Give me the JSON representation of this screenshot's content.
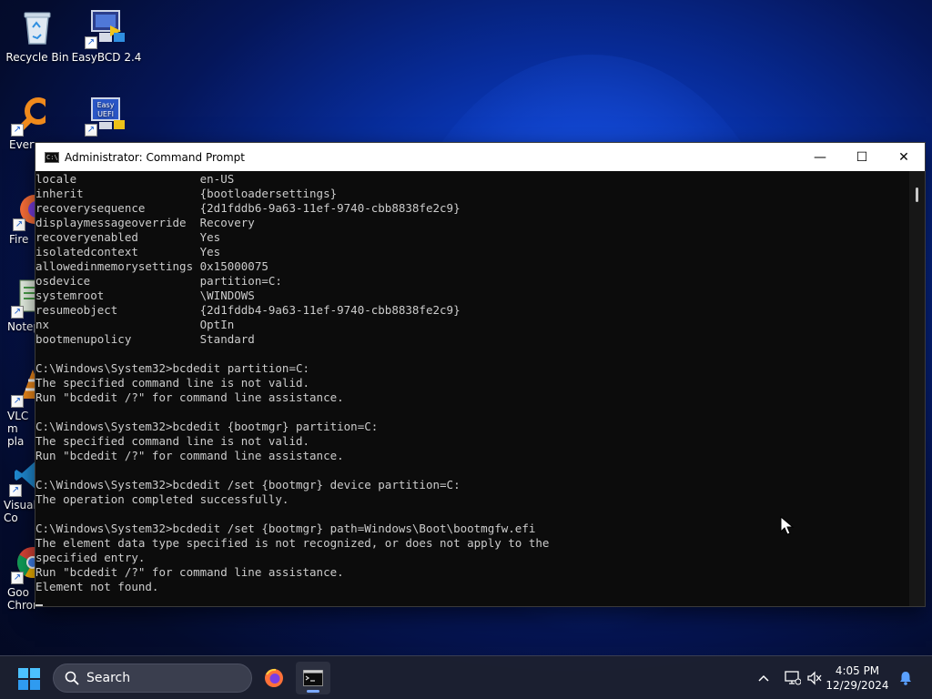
{
  "desktop": {
    "icons": [
      {
        "label": "Recycle Bin"
      },
      {
        "label": "EasyBCD 2.4"
      },
      {
        "label": "Every"
      },
      {
        "label": "Easy UEFI",
        "badge": "Easy UEFI"
      },
      {
        "label": "Fire"
      },
      {
        "label": "Notep"
      },
      {
        "label": "VLC m pla"
      },
      {
        "label": "Visual Co"
      },
      {
        "label": "Goo Chrome"
      }
    ]
  },
  "window": {
    "title": "Administrator: Command Prompt",
    "icon_label": "C:\\",
    "controls": {
      "minimize": "—",
      "maximize": "☐",
      "close": "✕"
    }
  },
  "console": {
    "lines": [
      "locale                  en-US",
      "inherit                 {bootloadersettings}",
      "recoverysequence        {2d1fddb6-9a63-11ef-9740-cbb8838fe2c9}",
      "displaymessageoverride  Recovery",
      "recoveryenabled         Yes",
      "isolatedcontext         Yes",
      "allowedinmemorysettings 0x15000075",
      "osdevice                partition=C:",
      "systemroot              \\WINDOWS",
      "resumeobject            {2d1fddb4-9a63-11ef-9740-cbb8838fe2c9}",
      "nx                      OptIn",
      "bootmenupolicy          Standard",
      "",
      "C:\\Windows\\System32>bcdedit partition=C:",
      "The specified command line is not valid.",
      "Run \"bcdedit /?\" for command line assistance.",
      "",
      "C:\\Windows\\System32>bcdedit {bootmgr} partition=C:",
      "The specified command line is not valid.",
      "Run \"bcdedit /?\" for command line assistance.",
      "",
      "C:\\Windows\\System32>bcdedit /set {bootmgr} device partition=C:",
      "The operation completed successfully.",
      "",
      "C:\\Windows\\System32>bcdedit /set {bootmgr} path=Windows\\Boot\\bootmgfw.efi",
      "The element data type specified is not recognized, or does not apply to the",
      "specified entry.",
      "Run \"bcdedit /?\" for command line assistance.",
      "Element not found."
    ]
  },
  "taskbar": {
    "search_label": "Search",
    "time": "4:05 PM",
    "date": "12/29/2024"
  },
  "colors": {
    "console_bg": "#0c0c0c",
    "console_fg": "#cccccc",
    "accent": "#7aa8ff"
  }
}
